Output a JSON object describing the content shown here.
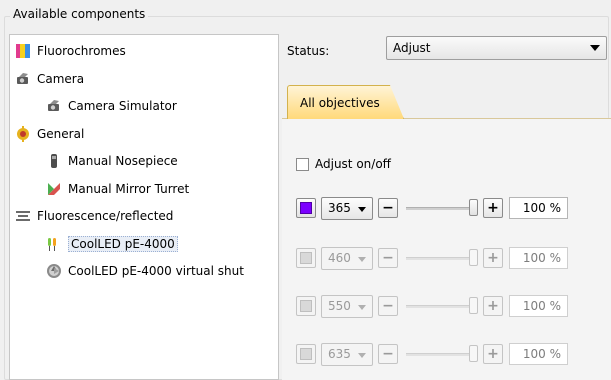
{
  "group_title": "Available components",
  "tree": [
    {
      "label": "Fluorochromes",
      "icon": "fluorochromes-icon",
      "indent": 0
    },
    {
      "label": "Camera",
      "icon": "camera-icon",
      "indent": 0
    },
    {
      "label": "Camera Simulator",
      "icon": "camera-icon",
      "indent": 1
    },
    {
      "label": "General",
      "icon": "general-icon",
      "indent": 0
    },
    {
      "label": "Manual Nosepiece",
      "icon": "nosepiece-icon",
      "indent": 1
    },
    {
      "label": "Manual Mirror Turret",
      "icon": "mirror-turret-icon",
      "indent": 1
    },
    {
      "label": "Fluorescence/reflected",
      "icon": "fluorescence-icon",
      "indent": 0
    },
    {
      "label": "CoolLED pE-4000",
      "icon": "led-icon",
      "indent": 1,
      "selected": true
    },
    {
      "label": "CoolLED pE-4000 virtual shut",
      "icon": "shutter-icon",
      "indent": 1
    }
  ],
  "status": {
    "label": "Status:",
    "value": "Adjust"
  },
  "tab": {
    "label": "All objectives"
  },
  "adjust_toggle": {
    "label": "Adjust on/off",
    "checked": false
  },
  "channels": [
    {
      "wavelength": "365",
      "percent": "100 %",
      "level": 1.0,
      "enabled": true,
      "color": "#7b00ff"
    },
    {
      "wavelength": "460",
      "percent": "100 %",
      "level": 1.0,
      "enabled": false,
      "color": "#d9d9d9"
    },
    {
      "wavelength": "550",
      "percent": "100 %",
      "level": 1.0,
      "enabled": false,
      "color": "#d9d9d9"
    },
    {
      "wavelength": "635",
      "percent": "100 %",
      "level": 1.0,
      "enabled": false,
      "color": "#d9d9d9"
    }
  ],
  "controls": {
    "minus": "−",
    "plus": "+"
  }
}
